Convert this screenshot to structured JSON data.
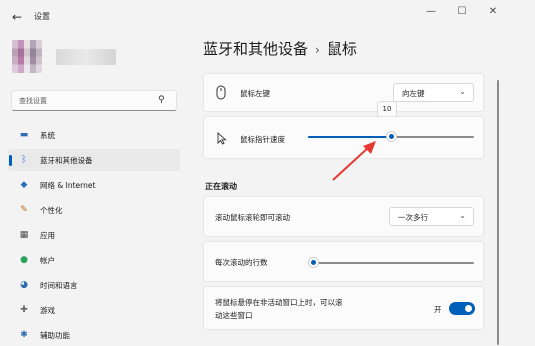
{
  "window": {
    "title": "设置",
    "back_glyph": "←",
    "minimize_glyph": "—",
    "maximize_glyph": "☐",
    "close_glyph": "✕"
  },
  "search": {
    "placeholder": "查找设置",
    "icon": "search-icon"
  },
  "sidebar": {
    "items": [
      {
        "label": "系统",
        "icon": "monitor-icon",
        "glyph": "▬",
        "color": "#2b6cb0",
        "active": false
      },
      {
        "label": "蓝牙和其他设备",
        "icon": "bluetooth-icon",
        "glyph": "ᛒ",
        "color": "#2f7fd6",
        "active": true
      },
      {
        "label": "网络 & Internet",
        "icon": "wifi-icon",
        "glyph": "◆",
        "color": "#2d6fbf",
        "active": false
      },
      {
        "label": "个性化",
        "icon": "brush-icon",
        "glyph": "✎",
        "color": "#c06a1d",
        "active": false
      },
      {
        "label": "应用",
        "icon": "apps-icon",
        "glyph": "▦",
        "color": "#4a4a4a",
        "active": false
      },
      {
        "label": "帐户",
        "icon": "person-icon",
        "glyph": "●",
        "color": "#27a35b",
        "active": false
      },
      {
        "label": "时间和语言",
        "icon": "globe-clock-icon",
        "glyph": "◕",
        "color": "#2b6cb0",
        "active": false
      },
      {
        "label": "游戏",
        "icon": "gamepad-icon",
        "glyph": "✚",
        "color": "#666666",
        "active": false
      },
      {
        "label": "辅助功能",
        "icon": "accessibility-icon",
        "glyph": "✱",
        "color": "#2b6cb0",
        "active": false
      }
    ]
  },
  "header": {
    "parent": "蓝牙和其他设备",
    "separator": "›",
    "current": "鼠标"
  },
  "settings": {
    "primary_button": {
      "label": "鼠标左键",
      "value": "向左键",
      "icon": "mouse-icon"
    },
    "pointer_speed": {
      "label": "鼠标指针速度",
      "value": 10,
      "max": 20,
      "tooltip": "10",
      "icon": "cursor-icon"
    },
    "scrolling_section": "正在滚动",
    "scroll_mode": {
      "label": "滚动鼠标滚轮即可滚动",
      "value": "一次多行"
    },
    "lines_per_scroll": {
      "label": "每次滚动的行数",
      "value": 3,
      "max": 100
    },
    "inactive_scroll": {
      "label_line1": "将鼠标悬停在非活动窗口上时，可以滚",
      "label_line2": "动这些窗口",
      "state": "开",
      "on": true
    }
  },
  "colors": {
    "accent": "#005fb8",
    "annotation_arrow": "#e53935"
  }
}
